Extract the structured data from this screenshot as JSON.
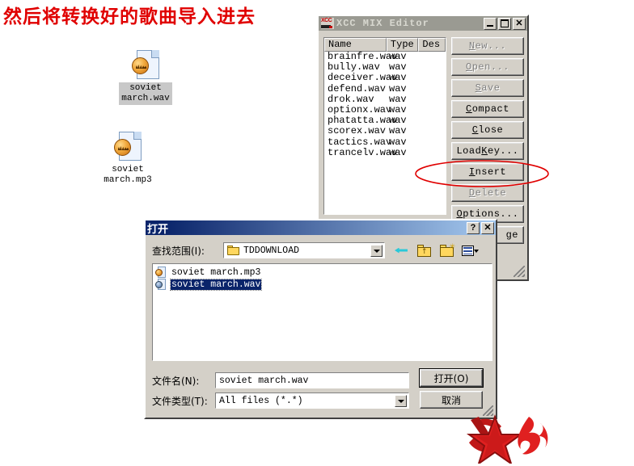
{
  "annotation": {
    "text": "然后将转换好的歌曲导入进去",
    "color": "#e00000",
    "highlight_target": "insert-button"
  },
  "desktop": {
    "icons": [
      {
        "name": "soviet march.wav",
        "line1": "soviet",
        "line2": "march.wav",
        "selected": true,
        "icon": "wav-file-icon"
      },
      {
        "name": "soviet march.mp3",
        "line1": "soviet",
        "line2": "march.mp3",
        "selected": false,
        "icon": "mp3-file-icon"
      }
    ]
  },
  "mix_editor": {
    "title": "XCC MIX Editor",
    "active": false,
    "window_buttons": {
      "minimize": "_",
      "maximize": "□",
      "close": "✕"
    },
    "columns": [
      "Name",
      "Type",
      "Des"
    ],
    "files": [
      {
        "name": "brainfre.wav",
        "type": "wav"
      },
      {
        "name": "bully.wav",
        "type": "wav"
      },
      {
        "name": "deceiver.wav",
        "type": "wav"
      },
      {
        "name": "defend.wav",
        "type": "wav"
      },
      {
        "name": "drok.wav",
        "type": "wav"
      },
      {
        "name": "optionx.wav",
        "type": "wav"
      },
      {
        "name": "phatatta.wav",
        "type": "wav"
      },
      {
        "name": "scorex.wav",
        "type": "wav"
      },
      {
        "name": "tactics.wav",
        "type": "wav"
      },
      {
        "name": "trancelv.wav",
        "type": "wav"
      }
    ],
    "buttons": [
      {
        "label": "New...",
        "disabled": true
      },
      {
        "label": "Open...",
        "disabled": true
      },
      {
        "label": "Save",
        "disabled": true
      },
      {
        "label": "Compact",
        "disabled": false
      },
      {
        "label": "Close",
        "disabled": false
      },
      {
        "label": "Load Key...",
        "disabled": false
      },
      {
        "label": "Insert",
        "disabled": false
      },
      {
        "label": "Delete",
        "disabled": true
      },
      {
        "label": "Options...",
        "disabled": false
      },
      {
        "label": "ge",
        "disabled": false
      }
    ]
  },
  "open_dialog": {
    "title": "打开",
    "help_button": "?",
    "close_button": "✕",
    "look_in_label": "查找范围(I):",
    "look_in_value": "TDDOWNLOAD",
    "nav_icons": [
      "back-icon",
      "up-folder-icon",
      "new-folder-icon",
      "views-icon"
    ],
    "files": [
      {
        "name": "soviet march.mp3",
        "selected": false,
        "icon": "mp3-file-icon"
      },
      {
        "name": "soviet march.wav",
        "selected": true,
        "icon": "wav-file-icon"
      }
    ],
    "file_name_label": "文件名(N):",
    "file_name_value": "soviet march.wav",
    "file_type_label": "文件类型(T):",
    "file_type_value": "All files (*.*)",
    "open_button": "打开(O)",
    "cancel_button": "取消"
  },
  "logo": {
    "name": "red-star-hammer-sickle-logo",
    "color": "#d11f1f"
  }
}
